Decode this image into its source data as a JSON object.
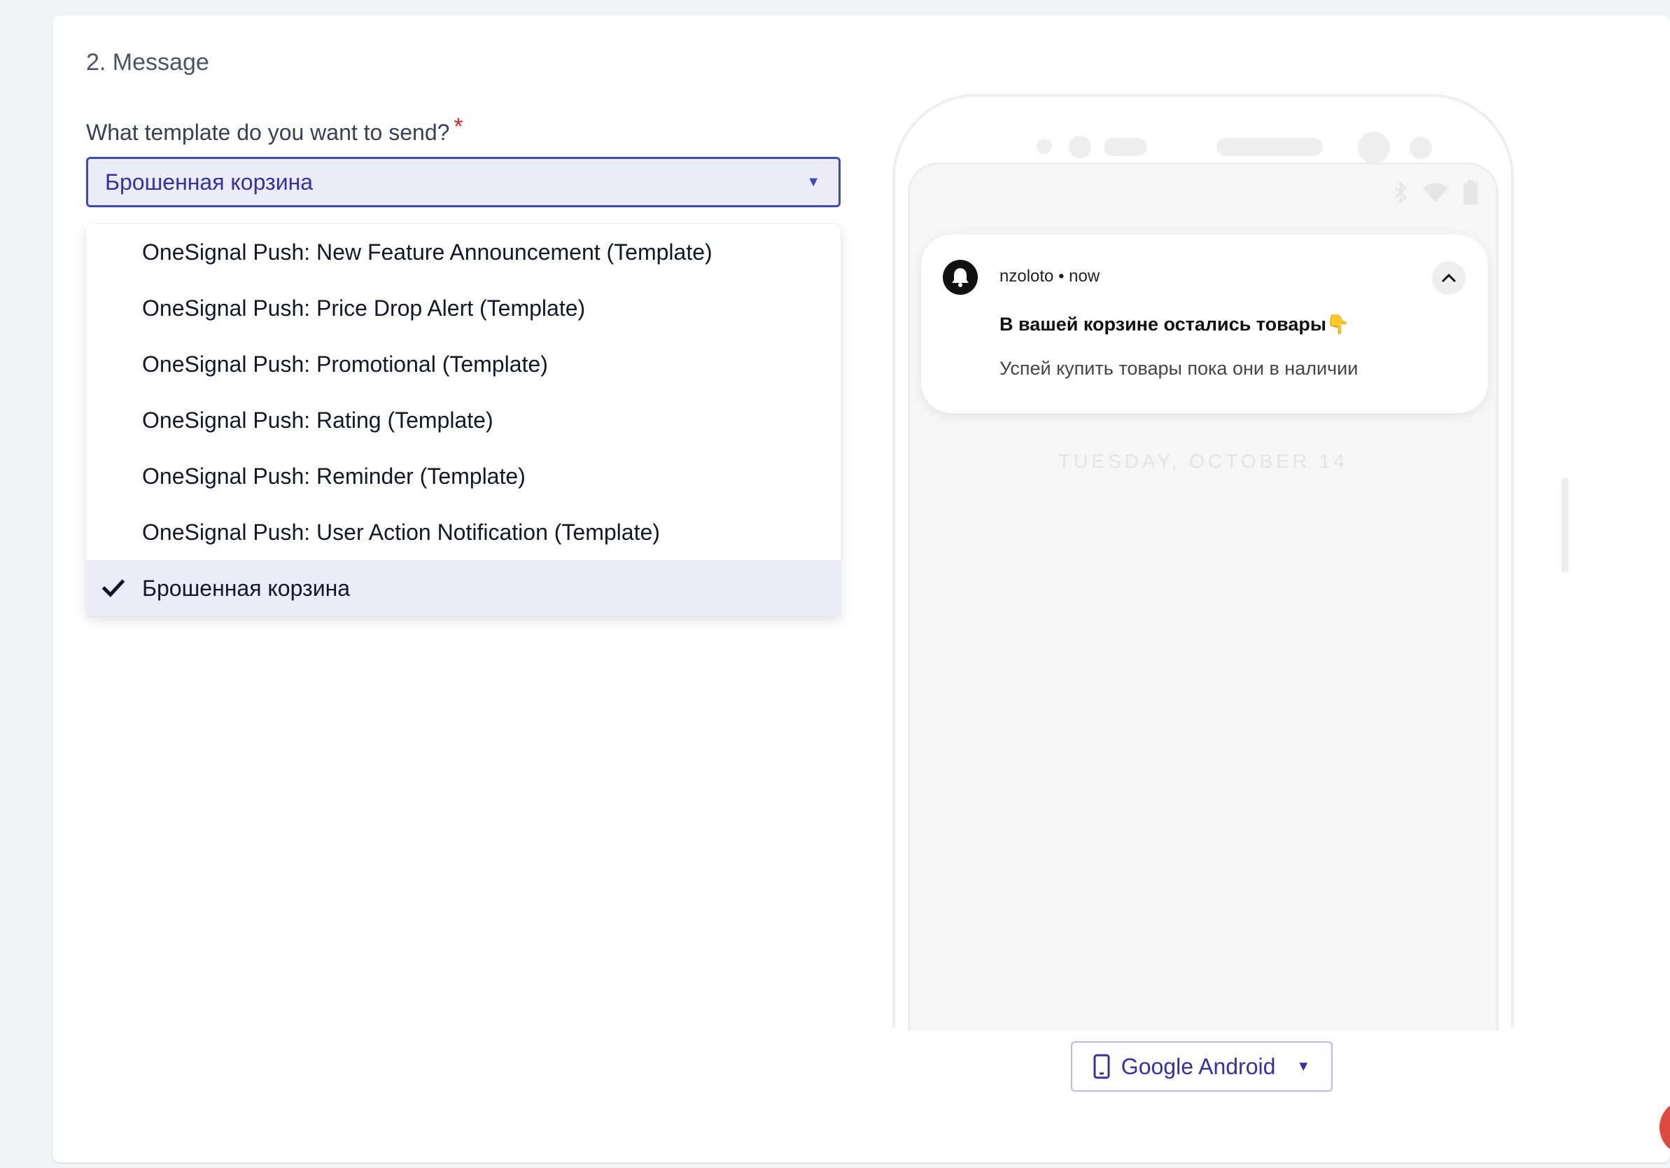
{
  "section": {
    "title": "2. Message"
  },
  "template_field": {
    "label": "What template do you want to send?",
    "required_mark": "*",
    "selected_value": "Брошенная корзина",
    "options": [
      {
        "label": "OneSignal Push: New Feature Announcement (Template)",
        "selected": false
      },
      {
        "label": "OneSignal Push: Price Drop Alert (Template)",
        "selected": false
      },
      {
        "label": "OneSignal Push: Promotional (Template)",
        "selected": false
      },
      {
        "label": "OneSignal Push: Rating (Template)",
        "selected": false
      },
      {
        "label": "OneSignal Push: Reminder (Template)",
        "selected": false
      },
      {
        "label": "OneSignal Push: User Action Notification (Template)",
        "selected": false
      },
      {
        "label": "Брошенная корзина",
        "selected": true
      }
    ]
  },
  "preview": {
    "notification": {
      "app_name": "nzoloto",
      "separator": "•",
      "time": "now",
      "title": "В вашей корзине остались товары👇",
      "body": "Успей купить товары пока они в наличии"
    },
    "date": "TUESDAY, OCTOBER 14",
    "platform_label": "Google Android"
  },
  "colors": {
    "accent": "#3f4ab3",
    "accent_text": "#3730a3",
    "selected_bg": "#ececf9",
    "required": "#dc2626"
  }
}
